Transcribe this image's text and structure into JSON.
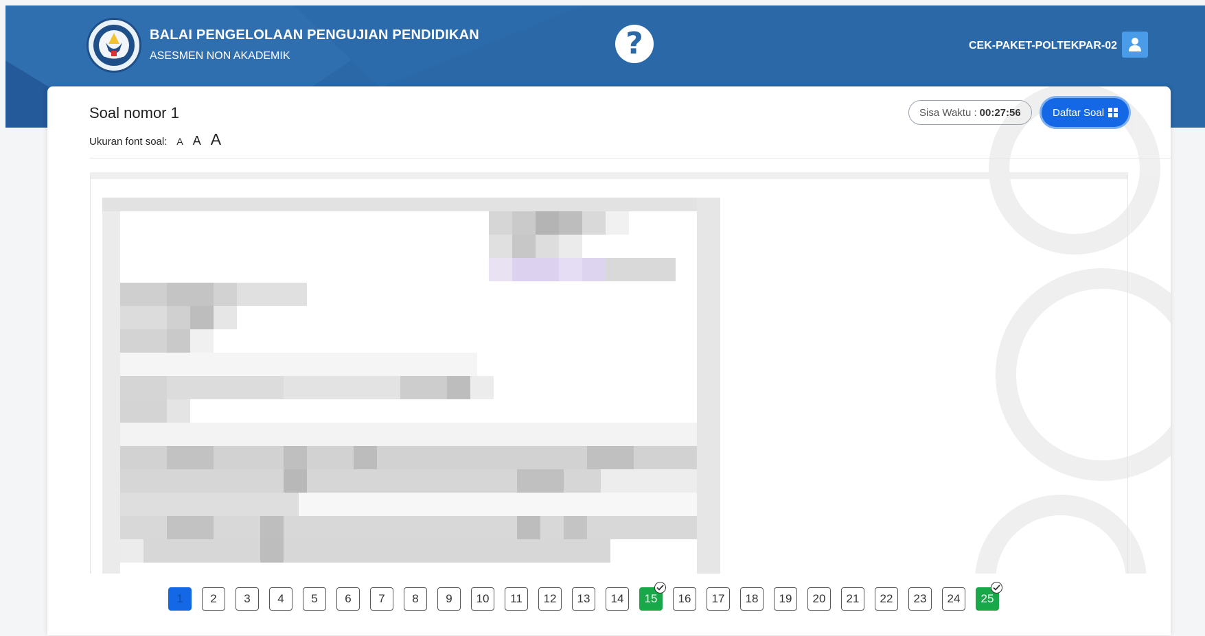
{
  "header": {
    "institution_title": "BALAI PENGELOLAAN PENGUJIAN PENDIDIKAN",
    "institution_subtitle": "ASESMEN NON AKADEMIK",
    "logo_icon": "tut-wuri-handayani-logo",
    "help_icon": "question-mark-icon",
    "username": "CEK-PAKET-POLTEKPAR-02",
    "user_icon": "user-icon",
    "brand_color": "#2a68a8"
  },
  "question": {
    "title": "Soal nomor 1",
    "font_size_label": "Ukuran font soal:",
    "font_sizes": [
      "A",
      "A",
      "A"
    ],
    "image": "question-image-blurred"
  },
  "timer": {
    "label": "Sisa Waktu :",
    "value": "00:27:56"
  },
  "daftar_soal": {
    "label": "Daftar Soal",
    "icon": "grid-icon",
    "color": "#1468e6"
  },
  "navigation": {
    "current": 1,
    "answered": [
      15,
      25
    ],
    "answered_color": "#18a84a",
    "items": [
      "1",
      "2",
      "3",
      "4",
      "5",
      "6",
      "7",
      "8",
      "9",
      "10",
      "11",
      "12",
      "13",
      "14",
      "15",
      "16",
      "17",
      "18",
      "19",
      "20",
      "21",
      "22",
      "23",
      "24",
      "25"
    ]
  }
}
